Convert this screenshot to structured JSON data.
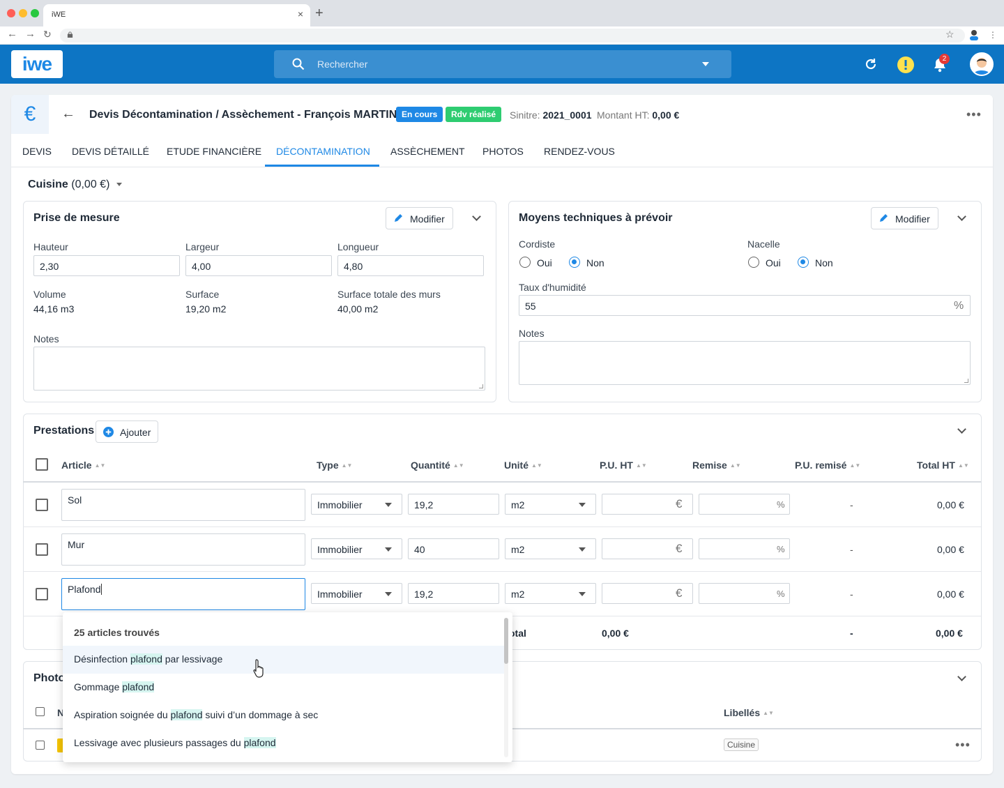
{
  "browser": {
    "tab_title": "iWE",
    "new_tab": "+",
    "close": "×"
  },
  "header": {
    "logo": "iwe",
    "search_placeholder": "Rechercher",
    "notifications_count": "2"
  },
  "page": {
    "back": "←",
    "title": "Devis Décontamination / Assèchement  - François MARTIN",
    "status_badges": [
      {
        "label": "En cours",
        "color": "#1e88e5"
      },
      {
        "label": "Rdv réalisé",
        "color": "#2ecc71"
      }
    ],
    "sinistre_label": "Sinitre:",
    "sinistre_value": "2021_0001",
    "montant_label": "Montant HT:",
    "montant_value": "0,00 €",
    "more": "•••"
  },
  "tabs": [
    "DEVIS",
    "DEVIS DÉTAILLÉ",
    "ETUDE FINANCIÈRE",
    "DÉCONTAMINATION",
    "ASSÈCHEMENT",
    "PHOTOS",
    "RENDEZ-VOUS"
  ],
  "active_tab": "DÉCONTAMINATION",
  "room": {
    "name": "Cuisine",
    "amount": "(0,00 €)"
  },
  "mesure": {
    "title": "Prise de mesure",
    "modify": "Modifier",
    "hauteur_label": "Hauteur",
    "hauteur": "2,30",
    "largeur_label": "Largeur",
    "largeur": "4,00",
    "longueur_label": "Longueur",
    "longueur": "4,80",
    "volume_label": "Volume",
    "volume": "44,16 m3",
    "surface_label": "Surface",
    "surface": "19,20 m2",
    "surface_murs_label": "Surface totale des murs",
    "surface_murs": "40,00 m2",
    "notes_label": "Notes"
  },
  "moyens": {
    "title": "Moyens techniques à prévoir",
    "modify": "Modifier",
    "cordiste_label": "Cordiste",
    "nacelle_label": "Nacelle",
    "oui": "Oui",
    "non": "Non",
    "cordiste_value": "Non",
    "nacelle_value": "Non",
    "humidite_label": "Taux d'humidité",
    "humidite": "55",
    "humidite_unit": "%",
    "notes_label": "Notes"
  },
  "prestations": {
    "title": "Prestations",
    "add": "Ajouter",
    "columns": [
      "Article",
      "Type",
      "Quantité",
      "Unité",
      "P.U. HT",
      "Remise",
      "P.U. remisé",
      "Total HT"
    ],
    "rows": [
      {
        "article": "Sol",
        "type": "Immobilier",
        "quantite": "19,2",
        "unite": "m2",
        "pu_unit": "€",
        "remise_unit": "%",
        "pu_remise": "-",
        "total": "0,00 €"
      },
      {
        "article": "Mur",
        "type": "Immobilier",
        "quantite": "40",
        "unite": "m2",
        "pu_unit": "€",
        "remise_unit": "%",
        "pu_remise": "-",
        "total": "0,00 €"
      },
      {
        "article": "Plafond",
        "type": "Immobilier",
        "quantite": "19,2",
        "unite": "m2",
        "pu_unit": "€",
        "remise_unit": "%",
        "pu_remise": "-",
        "total": "0,00 €"
      }
    ],
    "total_label": "otal",
    "total_pu": "0,00 €",
    "total_pu_remise": "-",
    "total_ht": "0,00 €"
  },
  "autocomplete": {
    "header": "25 articles trouvés",
    "items": [
      {
        "before": "Désinfection ",
        "match": "plafond",
        "after": " par lessivage"
      },
      {
        "before": "Gommage ",
        "match": "plafond",
        "after": ""
      },
      {
        "before": "Aspiration soignée du ",
        "match": "plafond",
        "after": " suivi d’un dommage à sec"
      },
      {
        "before": "Lessivage avec plusieurs passages du ",
        "match": "plafond",
        "after": ""
      }
    ]
  },
  "photos": {
    "title": "Photo",
    "col_n": "N",
    "col_libelles": "Libellés",
    "row_tag": "Cuisine",
    "more": "•••"
  }
}
